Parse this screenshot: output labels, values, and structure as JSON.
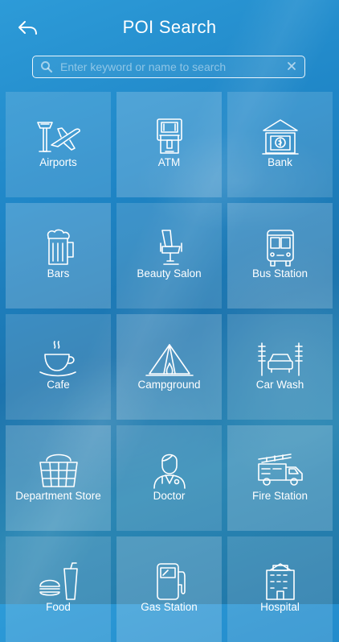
{
  "header": {
    "title": "POI Search"
  },
  "search": {
    "placeholder": "Enter keyword or name to search"
  },
  "categories": [
    {
      "label": "Airports",
      "icon": "airport-icon"
    },
    {
      "label": "ATM",
      "icon": "atm-icon"
    },
    {
      "label": "Bank",
      "icon": "bank-icon"
    },
    {
      "label": "Bars",
      "icon": "beer-icon"
    },
    {
      "label": "Beauty Salon",
      "icon": "salon-chair-icon"
    },
    {
      "label": "Bus Station",
      "icon": "bus-icon"
    },
    {
      "label": "Cafe",
      "icon": "coffee-cup-icon"
    },
    {
      "label": "Campground",
      "icon": "tent-icon"
    },
    {
      "label": "Car Wash",
      "icon": "car-wash-icon"
    },
    {
      "label": "Department Store",
      "icon": "basket-icon"
    },
    {
      "label": "Doctor",
      "icon": "doctor-icon"
    },
    {
      "label": "Fire Station",
      "icon": "fire-truck-icon"
    },
    {
      "label": "Food",
      "icon": "fast-food-icon"
    },
    {
      "label": "Gas Station",
      "icon": "fuel-pump-icon"
    },
    {
      "label": "Hospital",
      "icon": "hospital-icon"
    }
  ]
}
